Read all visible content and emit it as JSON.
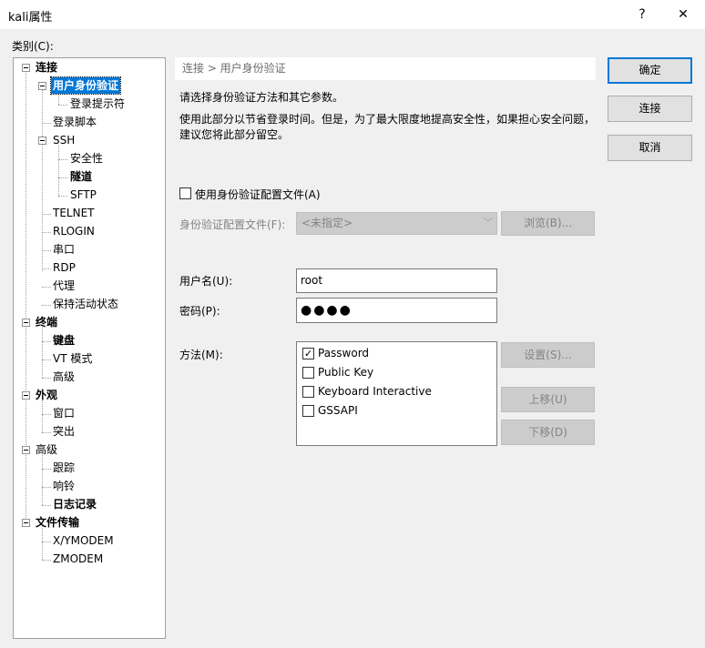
{
  "window": {
    "title": "kali属性",
    "help_label": "?",
    "close_label": "✕"
  },
  "category_label": "类别(C):",
  "tree": [
    {
      "label": "连接"
    },
    {
      "label": "用户身份验证"
    },
    {
      "label": "登录提示符"
    },
    {
      "label": "登录脚本"
    },
    {
      "label": "SSH"
    },
    {
      "label": "安全性"
    },
    {
      "label": "隧道"
    },
    {
      "label": "SFTP"
    },
    {
      "label": "TELNET"
    },
    {
      "label": "RLOGIN"
    },
    {
      "label": "串口"
    },
    {
      "label": "RDP"
    },
    {
      "label": "代理"
    },
    {
      "label": "保持活动状态"
    },
    {
      "label": "终端"
    },
    {
      "label": "键盘"
    },
    {
      "label": "VT 模式"
    },
    {
      "label": "高级"
    },
    {
      "label": "外观"
    },
    {
      "label": "窗口"
    },
    {
      "label": "突出"
    },
    {
      "label": "高级"
    },
    {
      "label": "跟踪"
    },
    {
      "label": "响铃"
    },
    {
      "label": "日志记录"
    },
    {
      "label": "文件传输"
    },
    {
      "label": "X/YMODEM"
    },
    {
      "label": "ZMODEM"
    }
  ],
  "breadcrumb": "连接 > 用户身份验证",
  "description": {
    "line1": "请选择身份验证方法和其它参数。",
    "line2": "使用此部分以节省登录时间。但是，为了最大限度地提高安全性，如果担心安全问题，",
    "line3": "建议您将此部分留空。"
  },
  "use_profile_label": "使用身份验证配置文件(A)",
  "use_profile_checked": false,
  "profile_label": "身份验证配置文件(F):",
  "profile_value": "<未指定>",
  "browse_label": "浏览(B)...",
  "username_label": "用户名(U):",
  "username_value": "root",
  "password_label": "密码(P):",
  "password_value": "●●●●",
  "method_label": "方法(M):",
  "methods": [
    {
      "label": "Password",
      "checked": true
    },
    {
      "label": "Public Key",
      "checked": false
    },
    {
      "label": "Keyboard Interactive",
      "checked": false
    },
    {
      "label": "GSSAPI",
      "checked": false
    }
  ],
  "settings_label": "设置(S)...",
  "move_up_label": "上移(U)",
  "move_down_label": "下移(D)",
  "ok_label": "确定",
  "connect_label": "连接",
  "cancel_label": "取消",
  "colors": {
    "selection": "#0078d7",
    "default_button_border": "#0078d7"
  },
  "check_glyph": "✓"
}
